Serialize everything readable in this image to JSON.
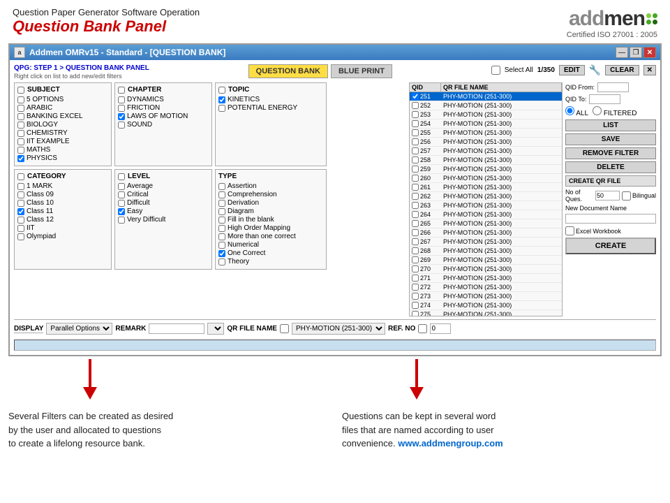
{
  "header": {
    "subtitle": "Question Paper Generator Software Operation",
    "title": "Question Bank Panel",
    "logo_text": "addmen",
    "certified": "Certified ISO 27001 : 2005"
  },
  "window": {
    "icon": "a",
    "title": "Addmen OMRv15 - Standard - [QUESTION BANK]",
    "controls": [
      "—",
      "❐",
      "✕"
    ]
  },
  "breadcrumb": {
    "step": "QPG: STEP 1 > QUESTION BANK PANEL",
    "hint": "Right click on list to add new/edit filters"
  },
  "tabs": {
    "active": "QUESTION BANK",
    "inactive": "BLUE PRINT"
  },
  "select_all": "Select All",
  "count": "1/350",
  "edit_btn": "EDIT",
  "clear_btn": "CLEAR",
  "subject": {
    "label": "SUBJECT",
    "items": [
      {
        "label": "5 OPTIONS",
        "checked": false
      },
      {
        "label": "ARABIC",
        "checked": false
      },
      {
        "label": "BANKING EXCEL",
        "checked": false
      },
      {
        "label": "BIOLOGY",
        "checked": false
      },
      {
        "label": "CHEMISTRY",
        "checked": false
      },
      {
        "label": "IIT EXAMPLE",
        "checked": false
      },
      {
        "label": "MATHS",
        "checked": false
      },
      {
        "label": "PHYSICS",
        "checked": true
      }
    ]
  },
  "chapter": {
    "label": "CHAPTER",
    "items": [
      {
        "label": "DYNAMICS",
        "checked": false
      },
      {
        "label": "FRICTION",
        "checked": false
      },
      {
        "label": "LAWS OF MOTION",
        "checked": true
      },
      {
        "label": "SOUND",
        "checked": false
      }
    ]
  },
  "topic": {
    "label": "TOPIC",
    "items": [
      {
        "label": "KINETICS",
        "checked": true
      },
      {
        "label": "POTENTIAL ENERGY",
        "checked": false
      }
    ]
  },
  "category": {
    "label": "CATEGORY",
    "checked": false,
    "items": [
      {
        "label": "1 MARK",
        "checked": false
      },
      {
        "label": "Class 09",
        "checked": false
      },
      {
        "label": "Class 10",
        "checked": false
      },
      {
        "label": "Class 11",
        "checked": true
      },
      {
        "label": "Class 12",
        "checked": false
      },
      {
        "label": "IIT",
        "checked": false
      },
      {
        "label": "Olympiad",
        "checked": false
      }
    ]
  },
  "level": {
    "label": "LEVEL",
    "checked": false,
    "items": [
      {
        "label": "Average",
        "checked": false
      },
      {
        "label": "Critical",
        "checked": false
      },
      {
        "label": "Difficult",
        "checked": false
      },
      {
        "label": "Easy",
        "checked": true
      },
      {
        "label": "Very Difficult",
        "checked": false
      }
    ]
  },
  "type": {
    "label": "TYPE",
    "items": [
      {
        "label": "Assertion",
        "checked": false
      },
      {
        "label": "Comprehension",
        "checked": false
      },
      {
        "label": "Derivation",
        "checked": false
      },
      {
        "label": "Diagram",
        "checked": false
      },
      {
        "label": "Fill in the blank",
        "checked": false
      },
      {
        "label": "High Order Mapping",
        "checked": false
      },
      {
        "label": "More than one correct",
        "checked": false
      },
      {
        "label": "Numerical",
        "checked": false
      },
      {
        "label": "One Correct",
        "checked": true
      },
      {
        "label": "Theory",
        "checked": false
      }
    ]
  },
  "qid_table": {
    "col1": "QID",
    "col2": "QR FILE NAME",
    "rows": [
      {
        "qid": "251",
        "file": "PHY-MOTION (251-300)",
        "selected": true
      },
      {
        "qid": "252",
        "file": "PHY-MOTION (251-300)",
        "selected": false
      },
      {
        "qid": "253",
        "file": "PHY-MOTION (251-300)",
        "selected": false
      },
      {
        "qid": "254",
        "file": "PHY-MOTION (251-300)",
        "selected": false
      },
      {
        "qid": "255",
        "file": "PHY-MOTION (251-300)",
        "selected": false
      },
      {
        "qid": "256",
        "file": "PHY-MOTION (251-300)",
        "selected": false
      },
      {
        "qid": "257",
        "file": "PHY-MOTION (251-300)",
        "selected": false
      },
      {
        "qid": "258",
        "file": "PHY-MOTION (251-300)",
        "selected": false
      },
      {
        "qid": "259",
        "file": "PHY-MOTION (251-300)",
        "selected": false
      },
      {
        "qid": "260",
        "file": "PHY-MOTION (251-300)",
        "selected": false
      },
      {
        "qid": "261",
        "file": "PHY-MOTION (251-300)",
        "selected": false
      },
      {
        "qid": "262",
        "file": "PHY-MOTION (251-300)",
        "selected": false
      },
      {
        "qid": "263",
        "file": "PHY-MOTION (251-300)",
        "selected": false
      },
      {
        "qid": "264",
        "file": "PHY-MOTION (251-300)",
        "selected": false
      },
      {
        "qid": "265",
        "file": "PHY-MOTION (251-300)",
        "selected": false
      },
      {
        "qid": "266",
        "file": "PHY-MOTION (251-300)",
        "selected": false
      },
      {
        "qid": "267",
        "file": "PHY-MOTION (251-300)",
        "selected": false
      },
      {
        "qid": "268",
        "file": "PHY-MOTION (251-300)",
        "selected": false
      },
      {
        "qid": "269",
        "file": "PHY-MOTION (251-300)",
        "selected": false
      },
      {
        "qid": "270",
        "file": "PHY-MOTION (251-300)",
        "selected": false
      },
      {
        "qid": "271",
        "file": "PHY-MOTION (251-300)",
        "selected": false
      },
      {
        "qid": "272",
        "file": "PHY-MOTION (251-300)",
        "selected": false
      },
      {
        "qid": "273",
        "file": "PHY-MOTION (251-300)",
        "selected": false
      },
      {
        "qid": "274",
        "file": "PHY-MOTION (251-300)",
        "selected": false
      },
      {
        "qid": "275",
        "file": "PHY-MOTION (251-300)",
        "selected": false
      }
    ]
  },
  "right_panel": {
    "qid_from_label": "QID From:",
    "qid_to_label": "QID To:",
    "all_label": "ALL",
    "filtered_label": "FILTERED",
    "list_btn": "LIST",
    "save_btn": "SAVE",
    "remove_filter_btn": "REMOVE FILTER",
    "delete_btn": "DELETE",
    "create_qr_label": "CREATE QR FILE",
    "no_ques_label": "No of Ques.",
    "no_ques_value": "50",
    "bilingual_label": "Bilingual",
    "doc_name_label": "New Document Name",
    "excel_label": "Excel Workbook",
    "create_btn": "CREATE"
  },
  "bottom": {
    "display_label": "DISPLAY",
    "remark_label": "REMARK",
    "qr_file_label": "QR FILE NAME",
    "ref_no_label": "REF. NO",
    "display_value": "Parallel Options",
    "qr_file_value": "PHY-MOTION (251-300)",
    "ref_no_value": "0"
  },
  "annotations": {
    "left": "Several Filters can be created as desired\nby the user and allocated to questions\nto create a lifelong resource bank.",
    "right_text": "Questions can be kept in several word\nfiles that are named according to user\nconvenience.",
    "right_link": "www.addmengroup.com"
  }
}
